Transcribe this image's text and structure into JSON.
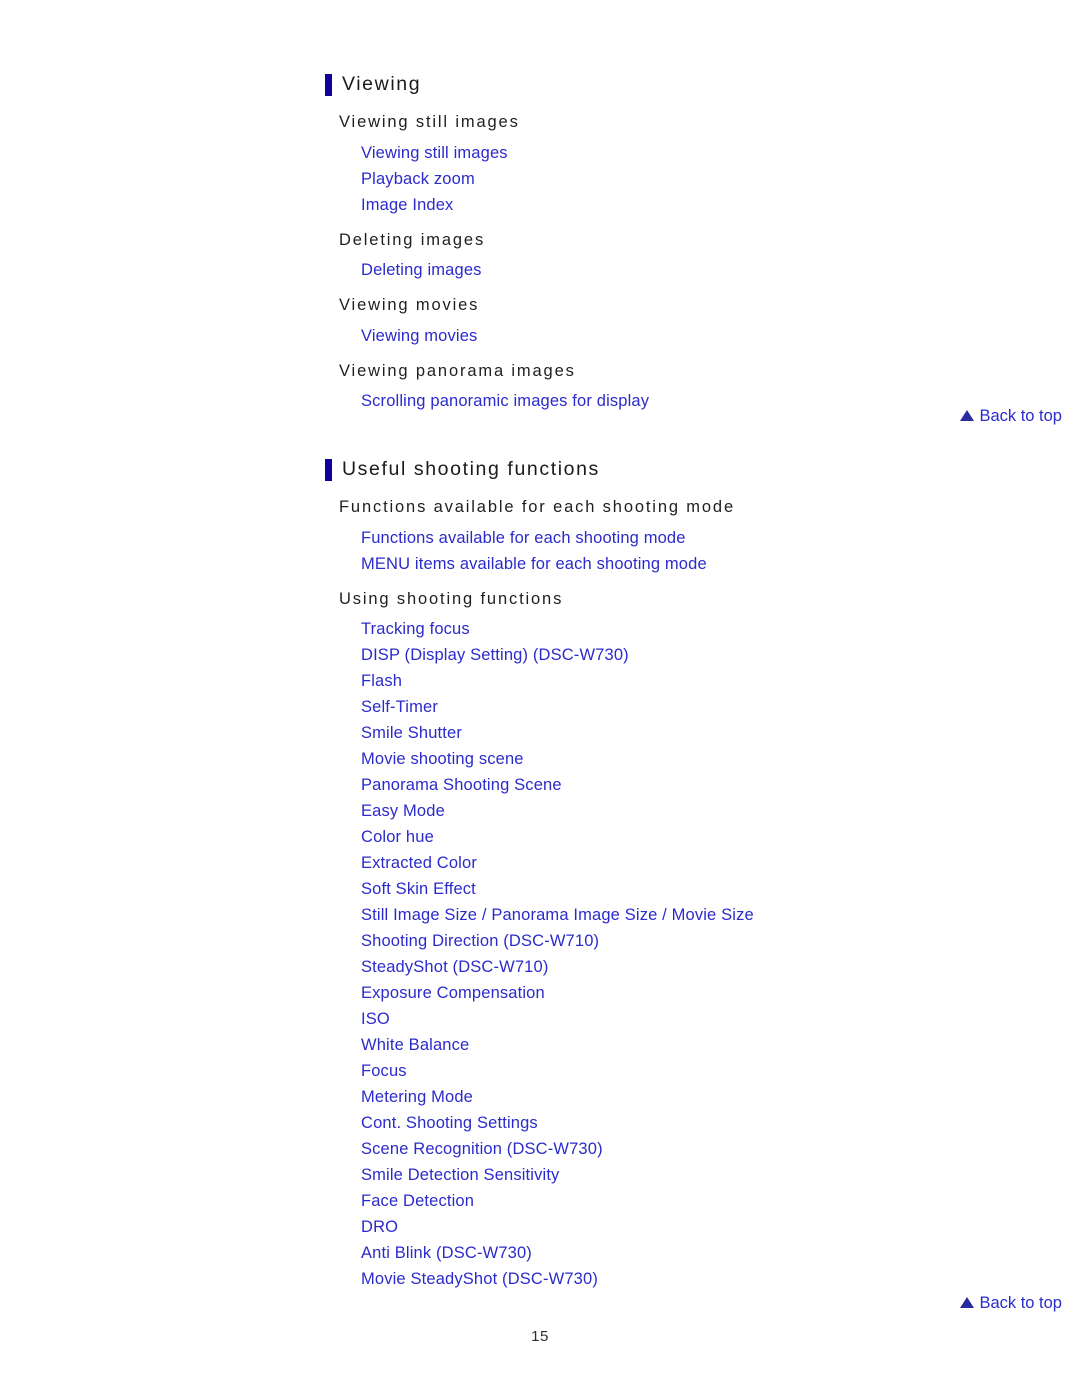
{
  "page": {
    "number": "15",
    "colors": {
      "link": "#2b2bcc",
      "section_bar": "#110099",
      "heading_text": "#1a1a1a",
      "back_to_top_arrow": "#2a2a9e",
      "background": "#ffffff"
    }
  },
  "sections": [
    {
      "title": "Viewing",
      "groups": [
        {
          "heading": "Viewing still images",
          "links": [
            "Viewing still images",
            "Playback zoom",
            "Image Index"
          ]
        },
        {
          "heading": "Deleting images",
          "links": [
            "Deleting images"
          ]
        },
        {
          "heading": "Viewing movies",
          "links": [
            "Viewing movies"
          ]
        },
        {
          "heading": "Viewing panorama images",
          "links": [
            "Scrolling panoramic images for display"
          ]
        }
      ]
    },
    {
      "title": "Useful shooting functions",
      "groups": [
        {
          "heading": "Functions available for each shooting mode",
          "links": [
            "Functions available for each shooting mode",
            "MENU items available for each shooting mode"
          ]
        },
        {
          "heading": "Using shooting functions",
          "links": [
            "Tracking focus",
            "DISP (Display Setting) (DSC-W730)",
            "Flash",
            "Self-Timer",
            "Smile Shutter",
            "Movie shooting scene",
            "Panorama Shooting Scene",
            "Easy Mode",
            "Color hue",
            "Extracted Color",
            "Soft Skin Effect",
            "Still Image Size / Panorama Image Size / Movie Size",
            "Shooting Direction (DSC-W710)",
            "SteadyShot (DSC-W710)",
            "Exposure Compensation",
            "ISO",
            "White Balance",
            "Focus",
            "Metering Mode",
            "Cont. Shooting Settings",
            "Scene Recognition (DSC-W730)",
            "Smile Detection Sensitivity",
            "Face Detection",
            "DRO",
            "Anti Blink (DSC-W730)",
            "Movie SteadyShot (DSC-W730)"
          ]
        }
      ]
    }
  ],
  "back_to_top": {
    "label": "Back to top",
    "icon": "triangle-up-icon"
  }
}
